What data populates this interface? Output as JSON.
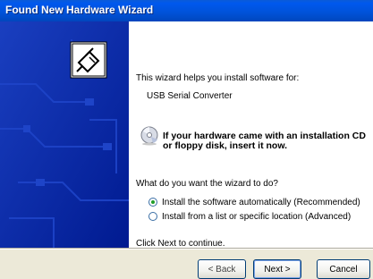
{
  "window": {
    "title": "Found New Hardware Wizard"
  },
  "content": {
    "intro": "This wizard helps you install software for:",
    "device_name": "USB Serial Converter",
    "cd_note_line1": "If your hardware came with an installation CD",
    "cd_note_line2": "or floppy disk, insert it now.",
    "question": "What do you want the wizard to do?",
    "options": [
      {
        "label": "Install the software automatically (Recommended)",
        "selected": true
      },
      {
        "label": "Install from a list or specific location (Advanced)",
        "selected": false
      }
    ],
    "continue_hint": "Click Next to continue."
  },
  "buttons": {
    "back": "< Back",
    "next": "Next >",
    "cancel": "Cancel"
  },
  "colors": {
    "titlebar": "#0052d8",
    "left_panel": "#0022a8",
    "dialog_bg": "#ece9d8"
  },
  "icons": {
    "wizard_graphic": "hardware-install-icon",
    "cd_icon": "cd-icon"
  }
}
